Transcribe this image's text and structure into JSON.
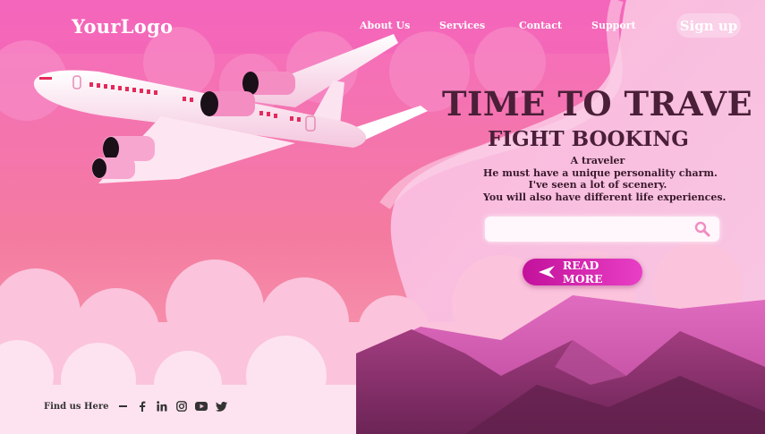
{
  "brand": {
    "logo_text": "YourLogo"
  },
  "nav": {
    "items": [
      "About Us",
      "Services",
      "Contact",
      "Support"
    ],
    "signup_label": "Sign up"
  },
  "hero": {
    "title": "TIME TO TRAVE",
    "subtitle": "FIGHT BOOKING",
    "description": [
      "A traveler",
      "He must have a unique personality charm.",
      "I've seen a lot of scenery.",
      "You will also have different life experiences."
    ]
  },
  "search": {
    "placeholder": "",
    "icon": "search-icon"
  },
  "cta": {
    "read_more_label": "READ MORE",
    "icon": "arrow-left-icon"
  },
  "footer": {
    "find_us_label": "Find us Here",
    "social_icons": [
      "facebook-icon",
      "linkedin-icon",
      "instagram-icon",
      "youtube-icon",
      "twitter-icon"
    ]
  },
  "colors": {
    "title": "#4a1f37",
    "cta_gradient_start": "#c3119b",
    "cta_gradient_end": "#e83fc5",
    "sky_top": "#f36fb7",
    "mountain": "#8b2f6e"
  }
}
